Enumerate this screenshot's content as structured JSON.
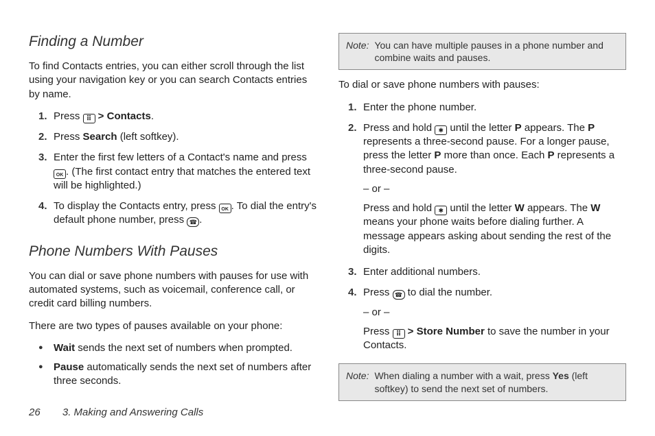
{
  "col1": {
    "heading1": "Finding a Number",
    "intro1": "To find Contacts entries, you can either scroll through the list using your navigation key or you can search Contacts entries by name.",
    "steps1": {
      "s1a": "Press ",
      "s1b": " > ",
      "s1c": "Contacts",
      "s1d": ".",
      "s2a": "Press ",
      "s2b": "Search",
      "s2c": " (left softkey).",
      "s3a": "Enter the first few letters of a Contact's name and press ",
      "s3b": ". (The first contact entry that matches the entered text will be highlighted.)",
      "s4a": "To display the Contacts entry, press ",
      "s4b": ". To dial the entry's default phone number, press ",
      "s4c": "."
    },
    "heading2": "Phone Numbers With Pauses",
    "intro2": "You can dial or save phone numbers with pauses for use with automated systems, such as voicemail, conference call, or credit card billing numbers.",
    "intro3": "There are two types of pauses available on your phone:",
    "bullets": {
      "b1a": "Wait",
      "b1b": " sends the next set of numbers when prompted.",
      "b2a": "Pause",
      "b2b": " automatically sends the next set of numbers after three seconds."
    }
  },
  "col2": {
    "note1": {
      "label": "Note:",
      "text": "You can have multiple pauses in a phone number and combine waits and pauses."
    },
    "lead": "To dial or save phone numbers with pauses:",
    "steps": {
      "s1": "Enter the phone number.",
      "s2a": "Press and hold ",
      "s2b": " until the letter ",
      "s2c": "P",
      "s2d": " appears. The ",
      "s2e": "P",
      "s2f": " represents a three-second pause. For a longer pause, press the letter ",
      "s2g": "P",
      "s2h": " more than once. Each ",
      "s2i": "P",
      "s2j": " represents a three-second pause.",
      "or": "– or –",
      "s2k": "Press and hold ",
      "s2l": " until the letter ",
      "s2m": "W",
      "s2n": " appears. The ",
      "s2o": "W",
      "s2p": " means your phone waits before dialing further. A message appears asking about sending the rest of the digits.",
      "s3": "Enter additional numbers.",
      "s4a": "Press ",
      "s4b": " to dial the number.",
      "s4or": "– or –",
      "s4c": "Press ",
      "s4d": " > ",
      "s4e": "Store Number",
      "s4f": " to save the number in your Contacts."
    },
    "note2": {
      "label": "Note:",
      "text1": "When dialing a number with a wait, press ",
      "text2": "Yes",
      "text3": " (left softkey) to send the next set of numbers."
    }
  },
  "footer": {
    "page": "26",
    "chapter": "3. Making and Answering Calls"
  }
}
